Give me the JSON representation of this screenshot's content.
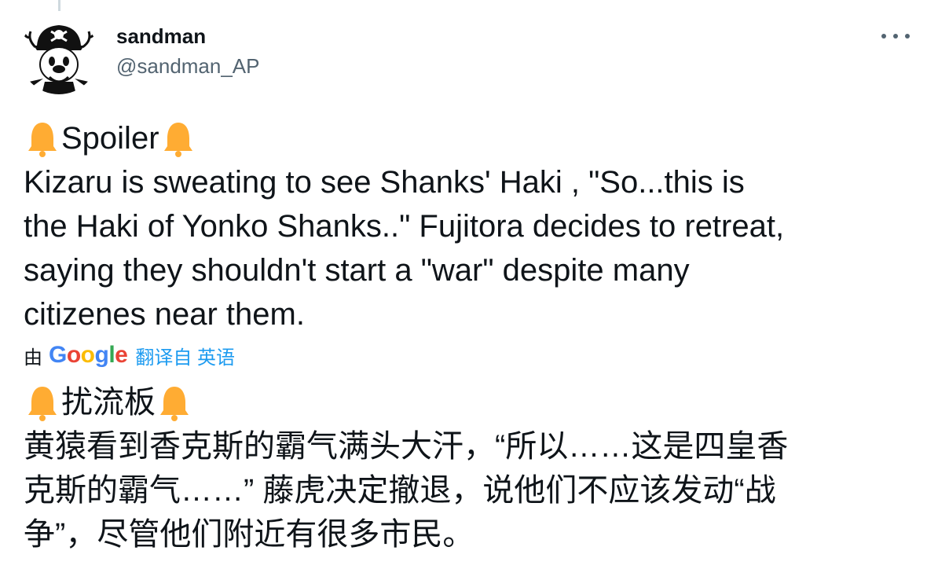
{
  "thread": {
    "has_line_above": true
  },
  "author": {
    "display_name": "sandman",
    "handle": "@sandman_AP",
    "avatar_icon": "pirate-chopper-avatar-icon"
  },
  "menu": {
    "icon": "more-dots-icon"
  },
  "tweet_en": {
    "title": "Spoiler",
    "bell_icon": "bell-emoji-icon",
    "lines": [
      "Kizaru is sweating to see Shanks' Haki , \"So...this is",
      "the Haki of Yonko Shanks..\" Fujitora decides to retreat,",
      "saying they shouldn't start a \"war\" despite many",
      "citizenes near them."
    ]
  },
  "translation": {
    "by_label": "由",
    "logo_text": "Google",
    "from_label": "翻译自 英语"
  },
  "tweet_zh": {
    "title": "扰流板",
    "lines": [
      "黄猿看到香克斯的霸气满头大汗，“所以……这是四皇香",
      "克斯的霸气……” 藤虎决定撤退，说他们不应该发动“战",
      "争”，尽管他们附近有很多市民。"
    ]
  },
  "colors": {
    "text": "#0f1419",
    "secondary": "#536471",
    "link": "#1d9bf0",
    "bell": "#ffac33"
  }
}
